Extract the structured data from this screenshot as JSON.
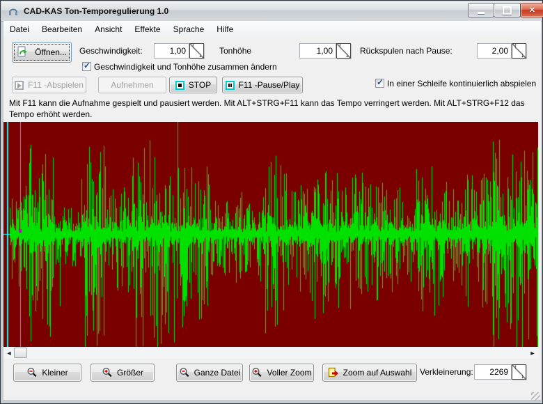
{
  "window": {
    "title": "CAD-KAS Ton-Temporegulierung 1.0"
  },
  "menu": {
    "items": [
      "Datei",
      "Bearbeiten",
      "Ansicht",
      "Effekte",
      "Sprache",
      "Hilfe"
    ]
  },
  "toolbar": {
    "open_label": "Öffnen...",
    "speed_label": "Geschwindigkeit:",
    "speed_value": "1,00",
    "pitch_label": "Tonhöhe",
    "pitch_value": "1,00",
    "rewind_label": "Rückspulen nach Pause:",
    "rewind_value": "2,00",
    "link_checkbox_label": "Geschwindigkeit und Tonhöhe zusammen ändern",
    "play_label": "F11 -Abspielen",
    "record_label": "Aufnehmen",
    "stop_label": "STOP",
    "pause_label": "F11 -Pause/Play",
    "loop_checkbox_label": "In einer Schleife kontinuierlich abspielen"
  },
  "info_text": "Mit F11 kann die Aufnahme gespielt und pausiert werden. Mit ALT+STRG+F11 kann das Tempo verringert werden. Mit ALT+STRG+F12 das Tempo erhöht werden.",
  "waveform": {
    "background_color": "#7a0000",
    "wave_color": "#00e100",
    "position_marker_color": "#00ffff",
    "selection_line_color": "#6f9fce",
    "selection_dot_color": "#cc00cc",
    "seed": 987654321
  },
  "bottom": {
    "smaller_label": "Kleiner",
    "larger_label": "Größer",
    "whole_file_label": "Ganze Datei",
    "full_zoom_label": "Voller Zoom",
    "zoom_selection_label": "Zoom auf Auswahl",
    "reduction_label": "Verkleinerung:",
    "reduction_value": "2269"
  }
}
